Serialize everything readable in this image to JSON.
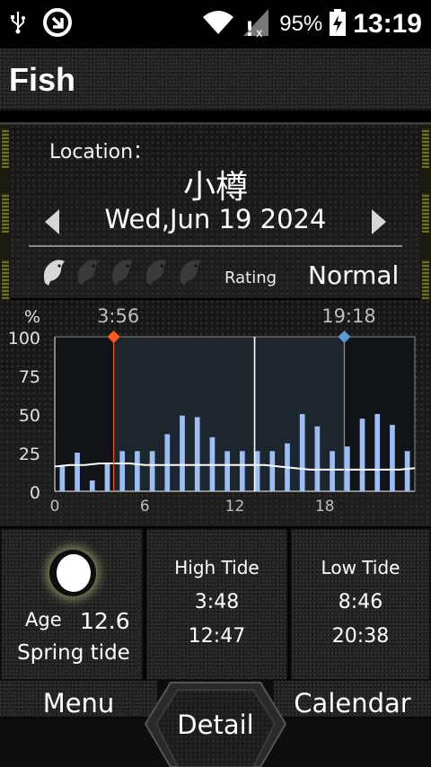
{
  "status_bar": {
    "battery": "95%",
    "time": "13:19",
    "icons": [
      "usb-icon",
      "data-saver-icon",
      "wifi-icon",
      "signal-no-sim-icon",
      "battery-charging-icon"
    ]
  },
  "title_bar": {
    "title": "Fish"
  },
  "info": {
    "location_label": "Location：",
    "location_name": "小樽",
    "date": "Wed,Jun 19 2024",
    "rating_label": "Rating",
    "rating_value": "Normal",
    "fish_rating": 1,
    "fish_total": 5
  },
  "chart_data": {
    "type": "bar",
    "ylabel": "%",
    "ylim": [
      0,
      100
    ],
    "yticks": [
      "0",
      "25",
      "50",
      "75",
      "100"
    ],
    "xlim": [
      0,
      24
    ],
    "xticks": [
      "0",
      "6",
      "12",
      "18"
    ],
    "x": [
      0.5,
      1.5,
      2.5,
      3.5,
      4.5,
      5.5,
      6.5,
      7.5,
      8.5,
      9.5,
      10.5,
      11.5,
      12.5,
      13.5,
      14.5,
      15.5,
      16.5,
      17.5,
      18.5,
      19.5,
      20.5,
      21.5,
      22.5,
      23.5
    ],
    "bars": [
      16,
      25,
      7,
      18,
      26,
      26,
      26,
      37,
      49,
      48,
      35,
      26,
      26,
      26,
      26,
      31,
      50,
      42,
      26,
      29,
      47,
      50,
      43,
      26
    ],
    "line_x": [
      0,
      1,
      2,
      3,
      4,
      5,
      6,
      7,
      8,
      9,
      10,
      11,
      12,
      13,
      14,
      15,
      16,
      17,
      18,
      19,
      20,
      21,
      22,
      23,
      24
    ],
    "line_y": [
      16,
      17,
      17,
      18,
      18,
      18,
      17,
      17,
      17,
      17,
      17,
      17,
      17,
      17,
      17,
      16,
      15,
      14,
      14,
      14,
      14,
      14,
      14,
      14,
      15
    ],
    "sunrise": {
      "label": "3:56",
      "x": 3.93,
      "color": "#ff5a1f"
    },
    "sunset": {
      "label": "19:18",
      "x": 19.3,
      "color": "#5b9bd5"
    },
    "current_time_x": 13.32,
    "bar_color": "#9dbdf5",
    "day_shade_color": "#2a3440"
  },
  "moon": {
    "age_label": "Age",
    "age_value": "12.6",
    "tide_type": "Spring tide"
  },
  "high_tide": {
    "title": "High Tide",
    "times": [
      "3:48",
      "12:47"
    ]
  },
  "low_tide": {
    "title": "Low Tide",
    "times": [
      "8:46",
      "20:38"
    ]
  },
  "nav": {
    "menu": "Menu",
    "detail": "Detail",
    "calendar": "Calendar"
  }
}
